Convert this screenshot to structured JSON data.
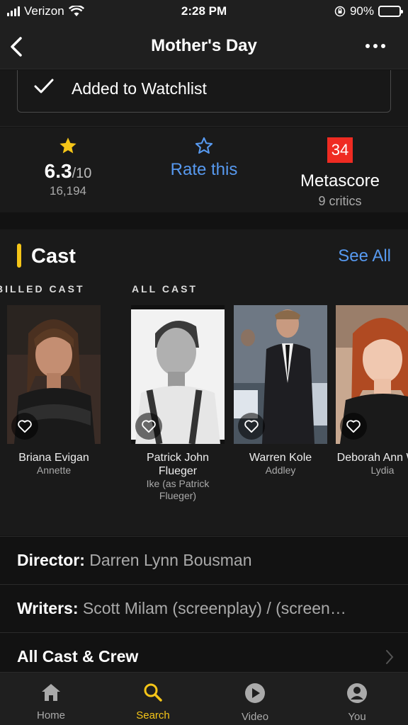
{
  "status": {
    "carrier": "Verizon",
    "time": "2:28 PM",
    "battery": "90%"
  },
  "nav": {
    "title": "Mother's Day"
  },
  "watchlist": {
    "label": "Added to Watchlist"
  },
  "ratings": {
    "imdb_score": "6.3",
    "imdb_outof": "/10",
    "imdb_votes": "16,194",
    "rate_label": "Rate this",
    "metascore": "34",
    "metascore_label": "Metascore",
    "critics": "9 critics"
  },
  "cast": {
    "title": "Cast",
    "see_all": "See All",
    "filters": [
      "BILLED CAST",
      "ALL CAST"
    ],
    "members": [
      {
        "name": "Briana Evigan",
        "role": "Annette"
      },
      {
        "name": "Patrick John Flueger",
        "role": "Ike (as Patrick Flueger)"
      },
      {
        "name": "Warren Kole",
        "role": "Addley"
      },
      {
        "name": "Deborah Ann Woll",
        "role": "Lydia"
      }
    ]
  },
  "credits": {
    "director_label": "Director:",
    "director_value": "Darren Lynn Bousman",
    "writers_label": "Writers:",
    "writers_value": "Scott Milam (screenplay) / (screen…",
    "all_cast_crew": "All Cast & Crew"
  },
  "tabs": [
    {
      "label": "Home"
    },
    {
      "label": "Search"
    },
    {
      "label": "Video"
    },
    {
      "label": "You"
    }
  ],
  "colors": {
    "accent": "#f5c518",
    "link": "#5799ef",
    "metascore_bg": "#ef2b22"
  }
}
